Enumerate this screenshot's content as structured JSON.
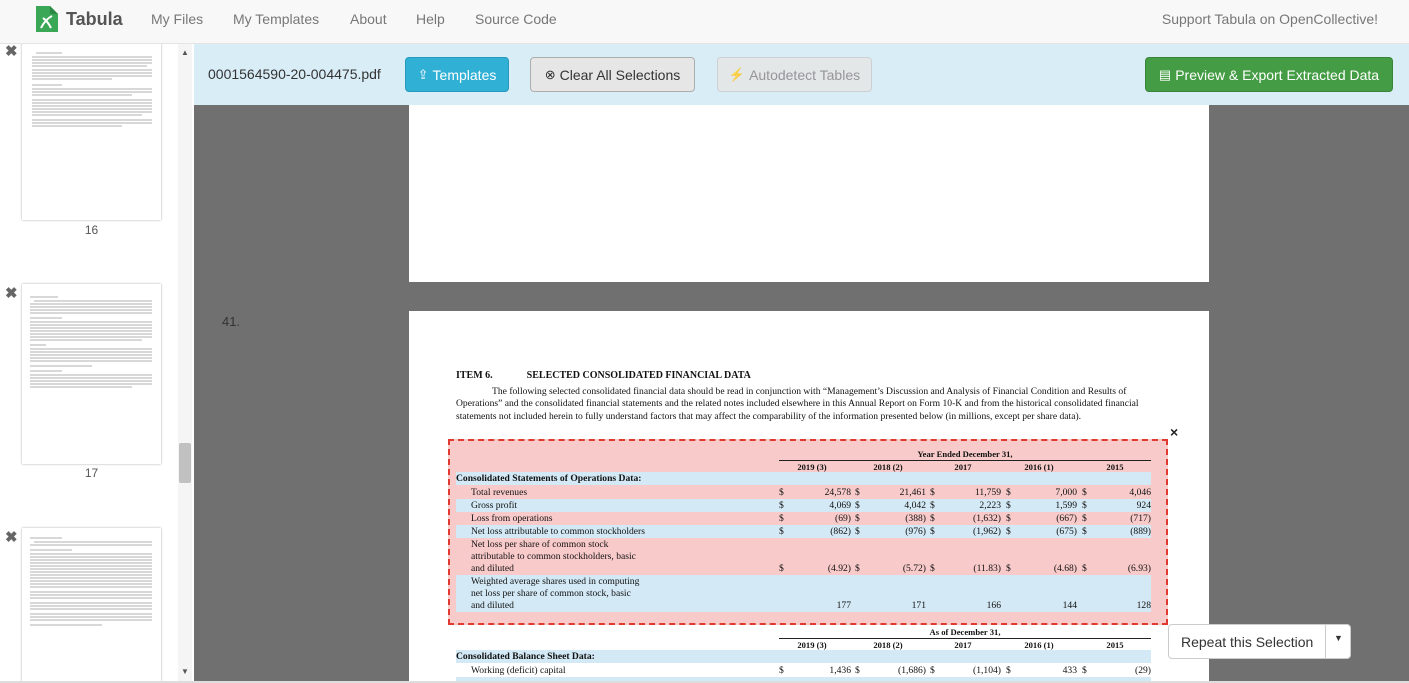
{
  "navbar": {
    "brand": "Tabula",
    "links": [
      "My Files",
      "My Templates",
      "About",
      "Help",
      "Source Code"
    ],
    "support": "Support Tabula on OpenCollective!"
  },
  "sidebar": {
    "thumbs": [
      {
        "number": "16"
      },
      {
        "number": "17"
      },
      {
        "number": ""
      }
    ]
  },
  "toolbar": {
    "filename": "0001564590-20-004475.pdf",
    "templates_label": "Templates",
    "clear_label": "Clear All Selections",
    "autodetect_label": "Autodetect Tables",
    "export_label": "Preview & Export Extracted Data"
  },
  "page": {
    "number_label": "41.",
    "item_number": "ITEM 6.",
    "item_title": "SELECTED CONSOLIDATED FINANCIAL DATA",
    "paragraph": "The following selected consolidated financial data should be read in conjunction with “Management’s Discussion and Analysis of Financial Condition and Results of Operations” and the consolidated financial statements and the related notes included elsewhere in this Annual Report on Form 10-K and from the historical consolidated financial statements not included herein to fully understand factors that may affect the comparability of the information presented below (in millions, except per share data).",
    "ops_header": "Year Ended December 31,",
    "bs_header": "As of December 31,",
    "years": [
      "2019 (3)",
      "2018 (2)",
      "2017",
      "2016 (1)",
      "2015"
    ],
    "ops_section": "Consolidated Statements of Operations Data:",
    "ops_rows": [
      {
        "label": "Total revenues",
        "dollar": true,
        "values": [
          "24,578",
          "21,461",
          "11,759",
          "7,000",
          "4,046"
        ]
      },
      {
        "label": "Gross profit",
        "dollar": true,
        "values": [
          "4,069",
          "4,042",
          "2,223",
          "1,599",
          "924"
        ]
      },
      {
        "label": "Loss from operations",
        "dollar": true,
        "values": [
          "(69)",
          "(388)",
          "(1,632)",
          "(667)",
          "(717)"
        ]
      },
      {
        "label": "Net loss attributable to common stockholders",
        "dollar": true,
        "values": [
          "(862)",
          "(976)",
          "(1,962)",
          "(675)",
          "(889)"
        ]
      },
      {
        "label": "Net loss per share of common stock\n  attributable to common stockholders, basic\n  and diluted",
        "dollar": true,
        "values": [
          "(4.92)",
          "(5.72)",
          "(11.83)",
          "(4.68)",
          "(6.93)"
        ]
      },
      {
        "label": "Weighted average shares used in computing\n  net loss per share of common stock, basic\n  and diluted",
        "dollar": false,
        "values": [
          "177",
          "171",
          "166",
          "144",
          "128"
        ]
      }
    ],
    "bs_section": "Consolidated Balance Sheet Data:",
    "bs_rows": [
      {
        "label": "Working (deficit) capital",
        "dollar": true,
        "values": [
          "1,436",
          "(1,686)",
          "(1,104)",
          "433",
          "(29)"
        ]
      }
    ],
    "dollar_sign": "$",
    "close_glyph": "×"
  },
  "repeat": {
    "label": "Repeat this Selection"
  },
  "colors": {
    "toolbar_bg": "#d9edf7",
    "templates_btn": "#31b0d5",
    "export_btn": "#449d44",
    "selection_border": "#e0392f",
    "row_band": "#d3e9f5"
  }
}
